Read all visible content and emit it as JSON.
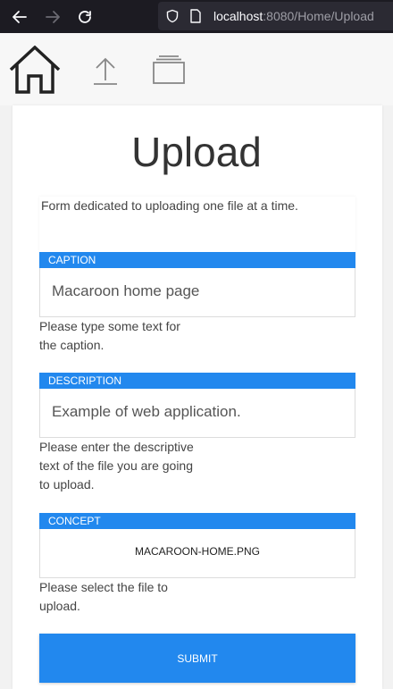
{
  "browser": {
    "url_host": "localhost",
    "url_rest": ":8080/Home/Upload"
  },
  "toolbar": {
    "icons": [
      "home-icon",
      "upload-icon",
      "windows-icon"
    ]
  },
  "page": {
    "title": "Upload",
    "intro": "Form dedicated to uploading one file at a time."
  },
  "fields": {
    "caption": {
      "label": "CAPTION",
      "value": "Macaroon home page",
      "help": "Please type some text for the caption."
    },
    "description": {
      "label": "DESCRIPTION",
      "value": "Example of web application.",
      "help": "Please enter the descriptive text of the file you are going to upload."
    },
    "concept": {
      "label": "CONCEPT",
      "file": "MACAROON-HOME.PNG",
      "help": "Please select the file to upload."
    }
  },
  "submit_label": "SUBMIT",
  "colors": {
    "accent": "#2288ee",
    "browser_bg": "#1c1b22"
  }
}
